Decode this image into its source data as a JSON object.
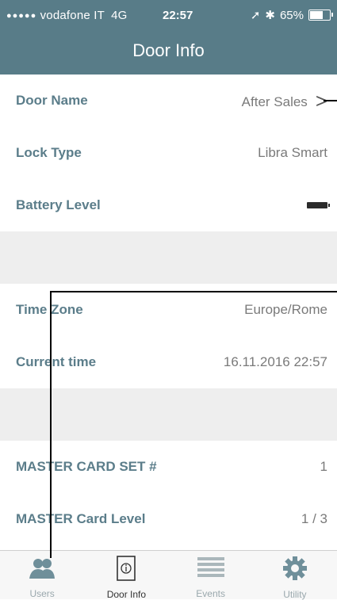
{
  "status_bar": {
    "signal_dots": "●●●●●",
    "carrier": "vodafone IT",
    "network": "4G",
    "time": "22:57",
    "battery_percent": "65%"
  },
  "nav": {
    "title": "Door Info"
  },
  "rows": [
    {
      "label": "Door Name",
      "value": "After Sales"
    },
    {
      "label": "Lock Type",
      "value": "Libra Smart"
    },
    {
      "label": "Battery Level",
      "value": ""
    },
    {
      "label": "Time Zone",
      "value": "Europe/Rome"
    },
    {
      "label": "Current time",
      "value": "16.11.2016 22:57"
    },
    {
      "label": "MASTER CARD SET #",
      "value": "1"
    },
    {
      "label": "MASTER Card Level",
      "value": "1 / 3"
    }
  ],
  "tabs": [
    {
      "label": "Users",
      "icon": "users-icon"
    },
    {
      "label": "Door Info",
      "icon": "door-info-icon"
    },
    {
      "label": "Events",
      "icon": "events-list-icon"
    },
    {
      "label": "Utility",
      "icon": "gear-icon"
    }
  ],
  "colors": {
    "bar": "#587c88",
    "label": "#5b7d8a",
    "value": "#7a7a7a",
    "gap": "#eeeeee"
  }
}
